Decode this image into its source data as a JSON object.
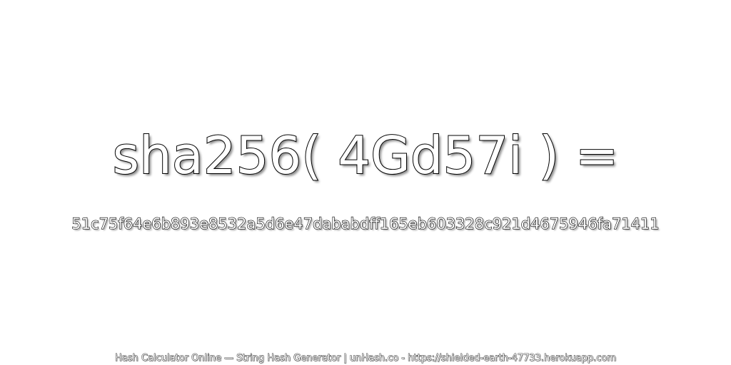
{
  "headline": "sha256( 4Gd57i ) =",
  "hash_value": "51c75f64e6b893e8532a5d6e47dababdff165eb603328c921d4675946fa71411",
  "footer": "Hash Calculator Online — String Hash Generator | unHash.co - https://shielded-earth-47733.herokuapp.com",
  "colors": {
    "background": "#ffffff",
    "text_fill": "#ffffff",
    "text_outline": "#000000"
  }
}
